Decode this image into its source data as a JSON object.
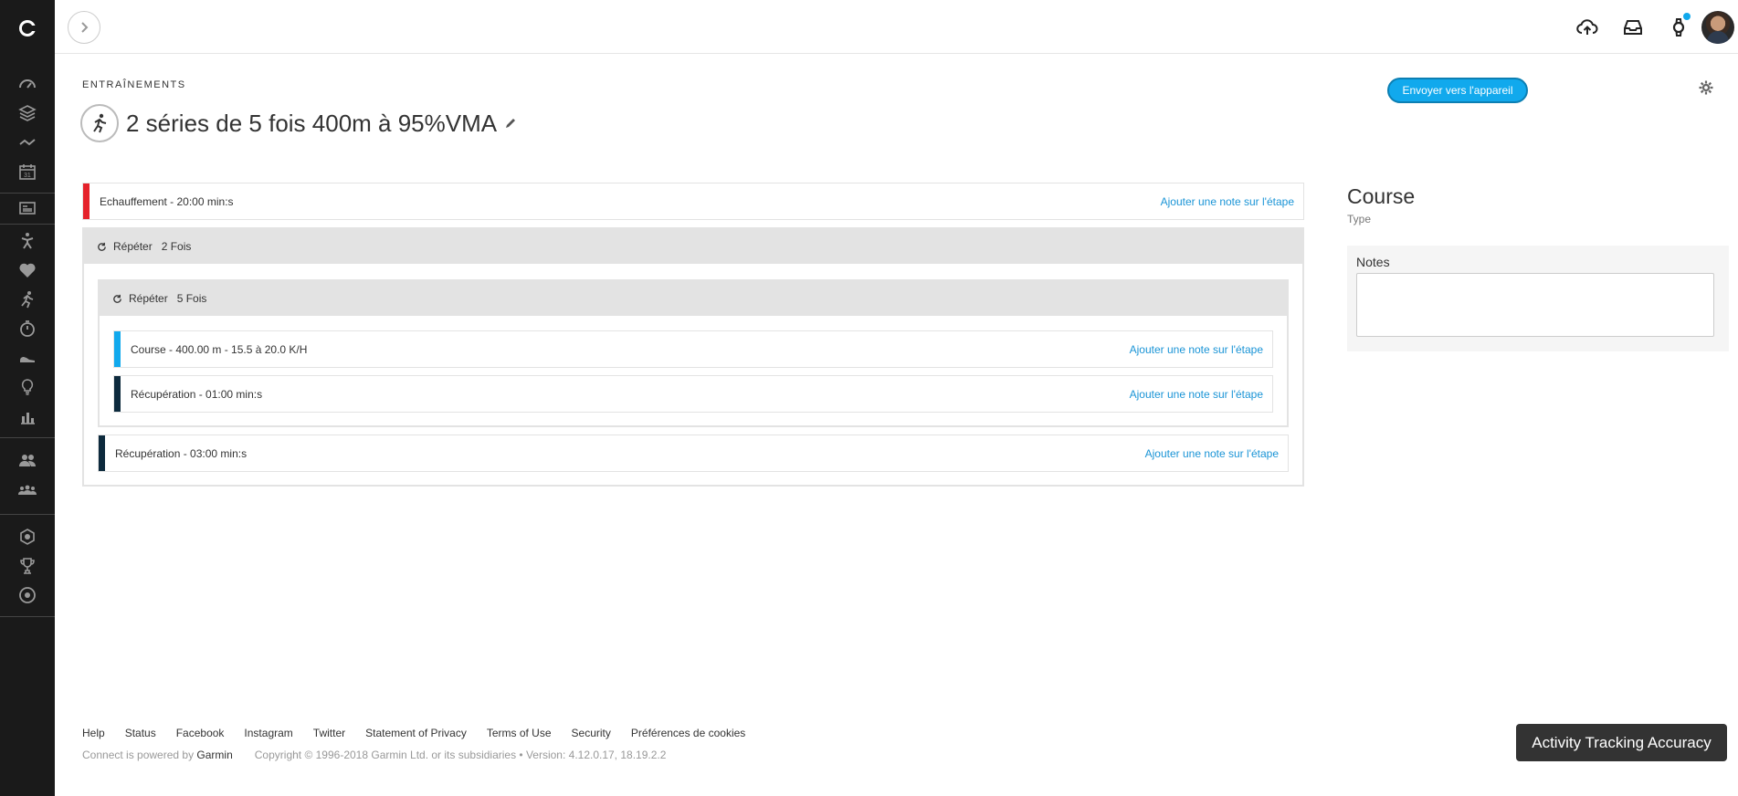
{
  "header": {
    "breadcrumb": "ENTRAÎNEMENTS",
    "title": "2 séries de 5 fois 400m à 95%VMA",
    "send_button": "Envoyer vers l'appareil"
  },
  "workout": {
    "add_note_label": "Ajouter une note sur l'étape",
    "warmup": {
      "label": "Echauffement - 20:00 min:s",
      "color": "#e5222b"
    },
    "outer_repeat": {
      "label": "Répéter",
      "count": "2 Fois"
    },
    "inner_repeat": {
      "label": "Répéter",
      "count": "5 Fois"
    },
    "run_step": {
      "label": "Course - 400.00 m - 15.5 à 20.0 K/H",
      "color": "#11a9ed"
    },
    "recovery_step": {
      "label": "Récupération - 01:00 min:s",
      "color": "#0d2a3d"
    },
    "long_recovery_step": {
      "label": "Récupération - 03:00 min:s",
      "color": "#0d2a3d"
    }
  },
  "side_panel": {
    "type_value": "Course",
    "type_label": "Type",
    "notes_label": "Notes",
    "notes_value": ""
  },
  "footer": {
    "links": [
      "Help",
      "Status",
      "Facebook",
      "Instagram",
      "Twitter",
      "Statement of Privacy",
      "Terms of Use",
      "Security",
      "Préférences de cookies"
    ],
    "powered_prefix": "Connect is powered by",
    "powered_brand": "Garmin",
    "copyright": "Copyright © 1996-2018 Garmin Ltd. or its subsidiaries • Version: 4.12.0.17, 18.19.2.2"
  },
  "accuracy_button": "Activity Tracking Accuracy",
  "colors": {
    "accent": "#11a9ed",
    "sidebar": "#1a1a1a"
  },
  "sidebar_icons": [
    "dashboard-icon",
    "layers-icon",
    "trend-icon",
    "calendar-icon",
    "news-icon",
    "activity-icon",
    "heart-icon",
    "running-icon",
    "stopwatch-icon",
    "shoe-icon",
    "lightbulb-icon",
    "bar-chart-icon",
    "connections-icon",
    "groups-icon",
    "badge-icon",
    "trophy-icon",
    "target-icon"
  ]
}
